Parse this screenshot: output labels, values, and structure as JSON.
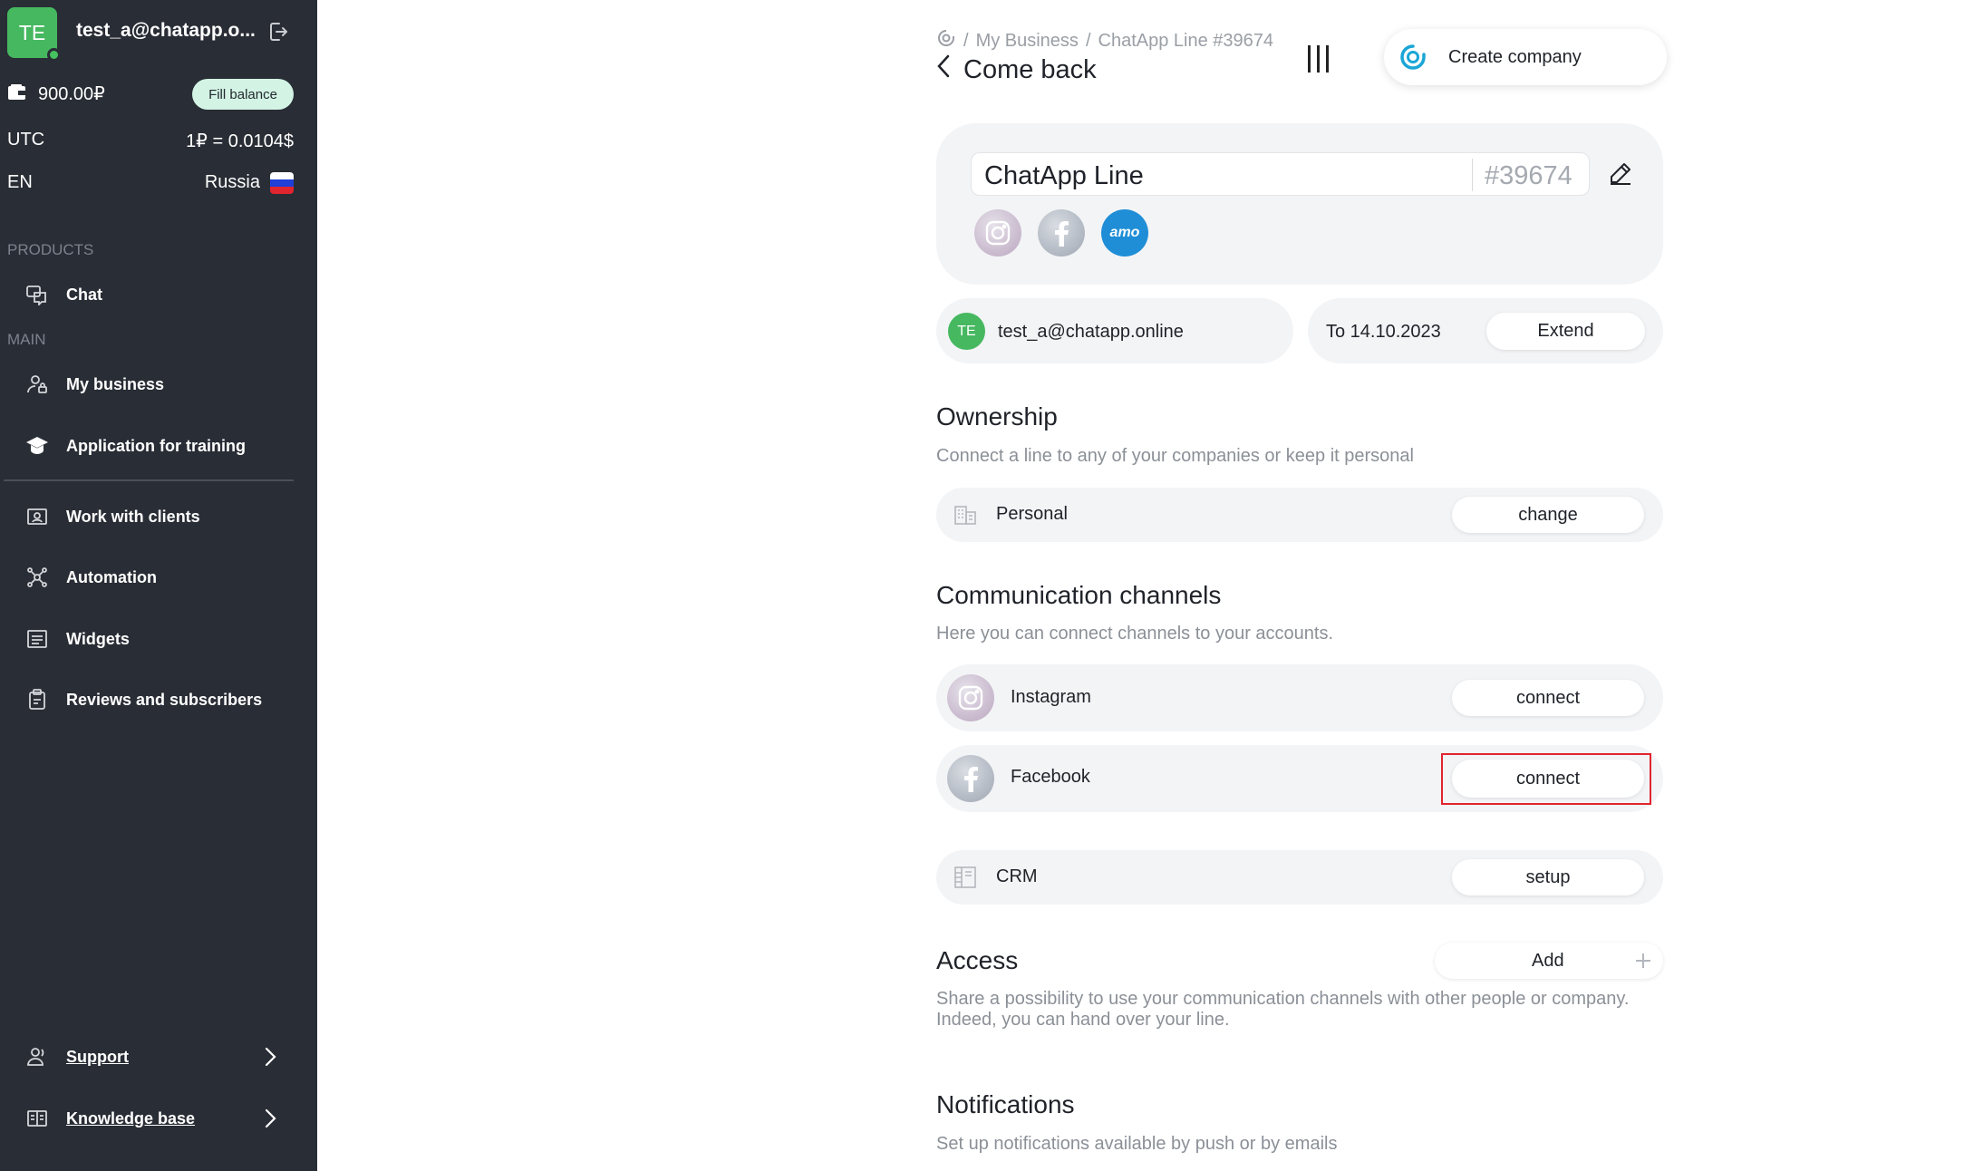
{
  "sidebar": {
    "avatar_initials": "TE",
    "user_email": "test_a@chatapp.o...",
    "balance": "900.00₽",
    "fill_balance_label": "Fill balance",
    "timezone": "UTC",
    "rate": "1₽ = 0.0104$",
    "language": "EN",
    "country": "Russia",
    "sections": {
      "products": "PRODUCTS",
      "main": "MAIN"
    },
    "items": {
      "chat": "Chat",
      "my_business": "My business",
      "training": "Application for training",
      "work_clients": "Work with clients",
      "automation": "Automation",
      "widgets": "Widgets",
      "reviews": "Reviews and subscribers",
      "support": "Support",
      "knowledge": "Knowledge base"
    }
  },
  "header": {
    "breadcrumb_sep": "/",
    "breadcrumb_1": "My Business",
    "breadcrumb_2": "ChatApp Line #39674",
    "back_label": "Come back",
    "create_company_label": "Create company"
  },
  "line": {
    "name": "ChatApp Line",
    "id": "#39674",
    "amo_label": "amo",
    "owner_initials": "TE",
    "owner_email": "test_a@chatapp.online",
    "valid_to": "To 14.10.2023",
    "extend_label": "Extend"
  },
  "ownership": {
    "title": "Ownership",
    "description": "Connect a line to any of your companies or keep it personal",
    "value": "Personal",
    "change_label": "change"
  },
  "channels": {
    "title": "Communication channels",
    "description": "Here you can connect channels to your accounts.",
    "items": [
      {
        "name": "Instagram",
        "action": "connect"
      },
      {
        "name": "Facebook",
        "action": "connect"
      },
      {
        "name": "CRM",
        "action": "setup"
      }
    ]
  },
  "access": {
    "title": "Access",
    "add_label": "Add",
    "description_line1": "Share a possibility to use your communication channels with other people or company.",
    "description_line2": "Indeed, you can hand over your line."
  },
  "notifications": {
    "title": "Notifications",
    "description": "Set up notifications available by push or by emails"
  },
  "colors": {
    "sidebar_bg": "#292d35",
    "accent_green": "#46b860",
    "fill_balance_bg": "#d3f4e4",
    "card_bg": "#f3f4f6",
    "highlight_red": "#e0252f"
  }
}
